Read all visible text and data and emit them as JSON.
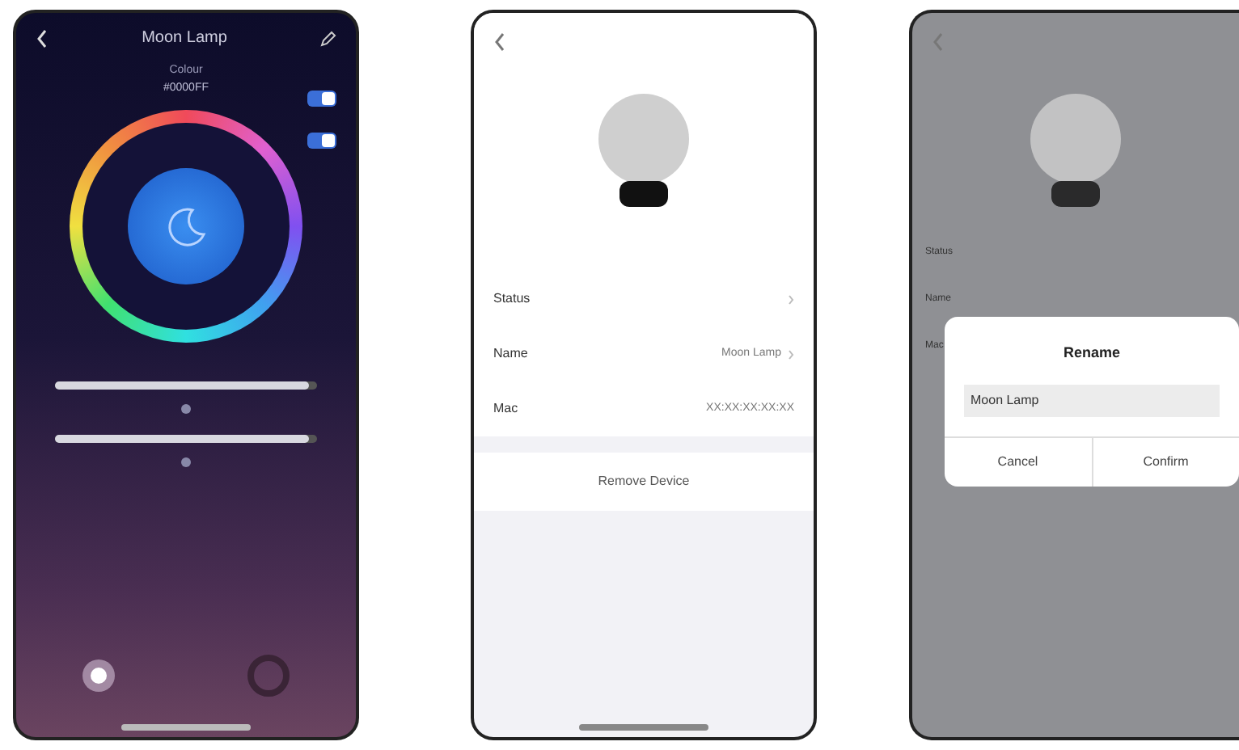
{
  "control_screen": {
    "title": "Moon Lamp",
    "status_label": "Colour",
    "status_value": "#0000FF",
    "toggles": [
      {
        "on": true
      },
      {
        "on": true
      }
    ],
    "sliders": [
      {
        "level": 0.97
      },
      {
        "level": 0.97
      }
    ]
  },
  "settings_screen": {
    "rows": [
      {
        "label": "Status",
        "value": ""
      },
      {
        "label": "Name",
        "value": "Moon Lamp"
      },
      {
        "label": "Mac",
        "value": "XX:XX:XX:XX:XX"
      }
    ],
    "remove_button": "Remove Device"
  },
  "rename_screen": {
    "rows": [
      "Status",
      "Name",
      "Mac"
    ],
    "dialog": {
      "title": "Rename",
      "value": "Moon Lamp",
      "buttons": [
        "Cancel",
        "Confirm"
      ]
    }
  }
}
